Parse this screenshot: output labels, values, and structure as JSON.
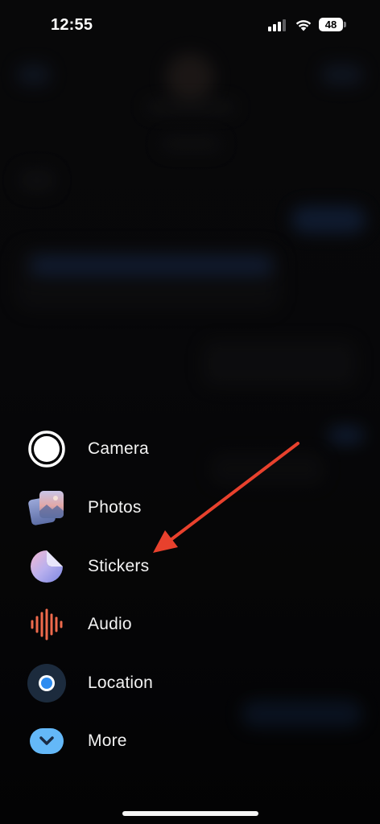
{
  "status_bar": {
    "time": "12:55",
    "battery": "48",
    "signal_bars_filled": 3,
    "signal_bars_total": 4
  },
  "menu": {
    "items": [
      {
        "label": "Camera",
        "icon": "camera-icon"
      },
      {
        "label": "Photos",
        "icon": "photos-icon"
      },
      {
        "label": "Stickers",
        "icon": "stickers-icon"
      },
      {
        "label": "Audio",
        "icon": "audio-waveform-icon"
      },
      {
        "label": "Location",
        "icon": "location-icon"
      },
      {
        "label": "More",
        "icon": "chevron-down-icon"
      }
    ]
  },
  "annotation": {
    "arrow_color": "#e8412d",
    "points_to": "Stickers"
  },
  "colors": {
    "background": "#000000",
    "label": "#f2f2f2",
    "location_blue": "#2e8cf0",
    "more_blue": "#64b8f8",
    "audio_red": "#ee6a4c"
  }
}
